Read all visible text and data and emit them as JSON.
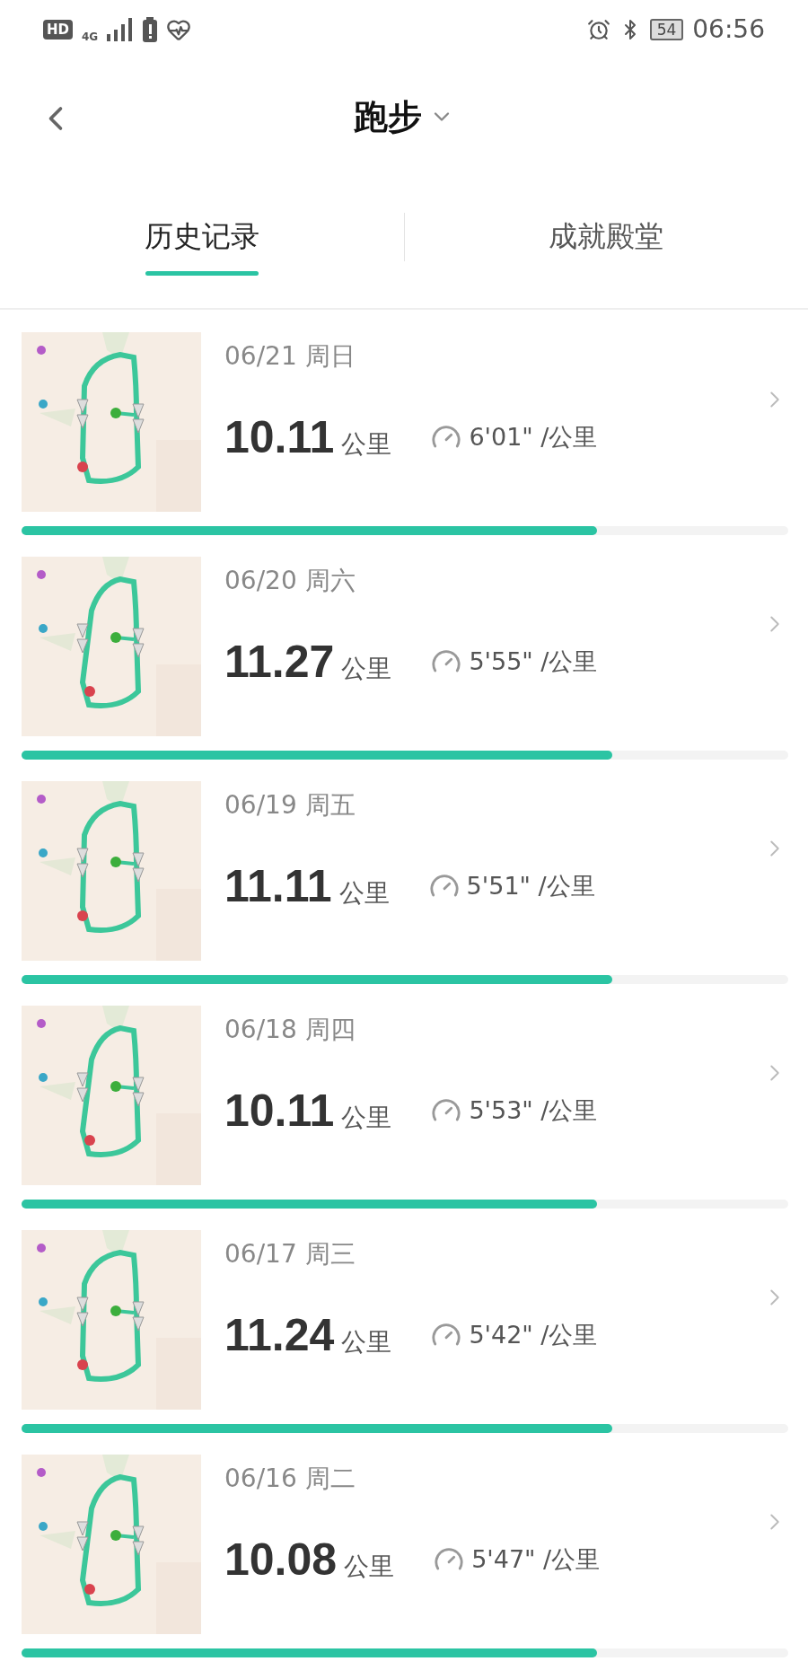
{
  "status_bar": {
    "hd_badge": "HD",
    "network": "4G",
    "battery": "54",
    "time": "06:56"
  },
  "header": {
    "title": "跑步"
  },
  "tabs": [
    {
      "label": "历史记录",
      "selected": true
    },
    {
      "label": "成就殿堂",
      "selected": false
    }
  ],
  "records": [
    {
      "date": "06/21 周日",
      "distance": "10.11",
      "distance_unit": "公里",
      "pace": "6'01\" /公里",
      "level": 0.75
    },
    {
      "date": "06/20 周六",
      "distance": "11.27",
      "distance_unit": "公里",
      "pace": "5'55\" /公里",
      "level": 0.77
    },
    {
      "date": "06/19 周五",
      "distance": "11.11",
      "distance_unit": "公里",
      "pace": "5'51\" /公里",
      "level": 0.77
    },
    {
      "date": "06/18 周四",
      "distance": "10.11",
      "distance_unit": "公里",
      "pace": "5'53\" /公里",
      "level": 0.75
    },
    {
      "date": "06/17 周三",
      "distance": "11.24",
      "distance_unit": "公里",
      "pace": "5'42\" /公里",
      "level": 0.77
    },
    {
      "date": "06/16 周二",
      "distance": "10.08",
      "distance_unit": "公里",
      "pace": "5'47\" /公里",
      "level": 0.75
    }
  ]
}
